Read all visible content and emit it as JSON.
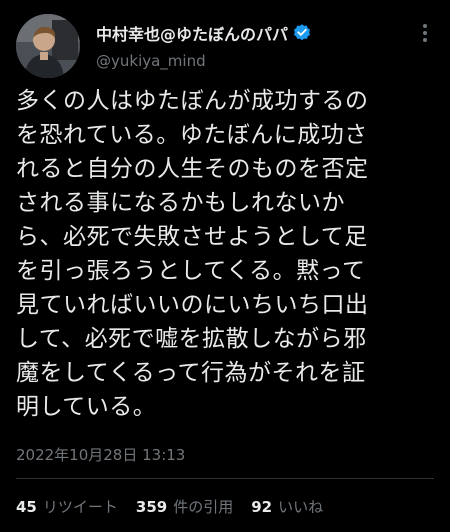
{
  "author": {
    "display_name": "中村幸也@ゆたぼんのパパ",
    "handle": "@yukiya_mind",
    "verified": true,
    "avatar_icon": "avatar-photo"
  },
  "tweet": {
    "lines": [
      "多くの人はゆたぼんが成功するの",
      "を恐れている。ゆたぼんに成功さ",
      "れると自分の人生そのものを否定",
      "される事になるかもしれないか",
      "ら、必死で失敗させようとして足",
      "を引っ張ろうとしてくる。黙って",
      "見ていればいいのにいちいち口出",
      "して、必死で嘘を拡散しながら邪",
      "魔をしてくるって行為がそれを証",
      "明している。"
    ],
    "timestamp": "2022年10月28日 13:13"
  },
  "stats": {
    "retweets_count": "45",
    "retweets_label": "リツイート",
    "quotes_count": "359",
    "quotes_label": "件の引用",
    "likes_count": "92",
    "likes_label": "いいね"
  },
  "colors": {
    "background": "#000000",
    "text": "#e7e9ea",
    "muted": "#71767b",
    "verified": "#1d9bf0"
  },
  "icons": [
    "verified-badge-icon",
    "more-options-icon"
  ]
}
